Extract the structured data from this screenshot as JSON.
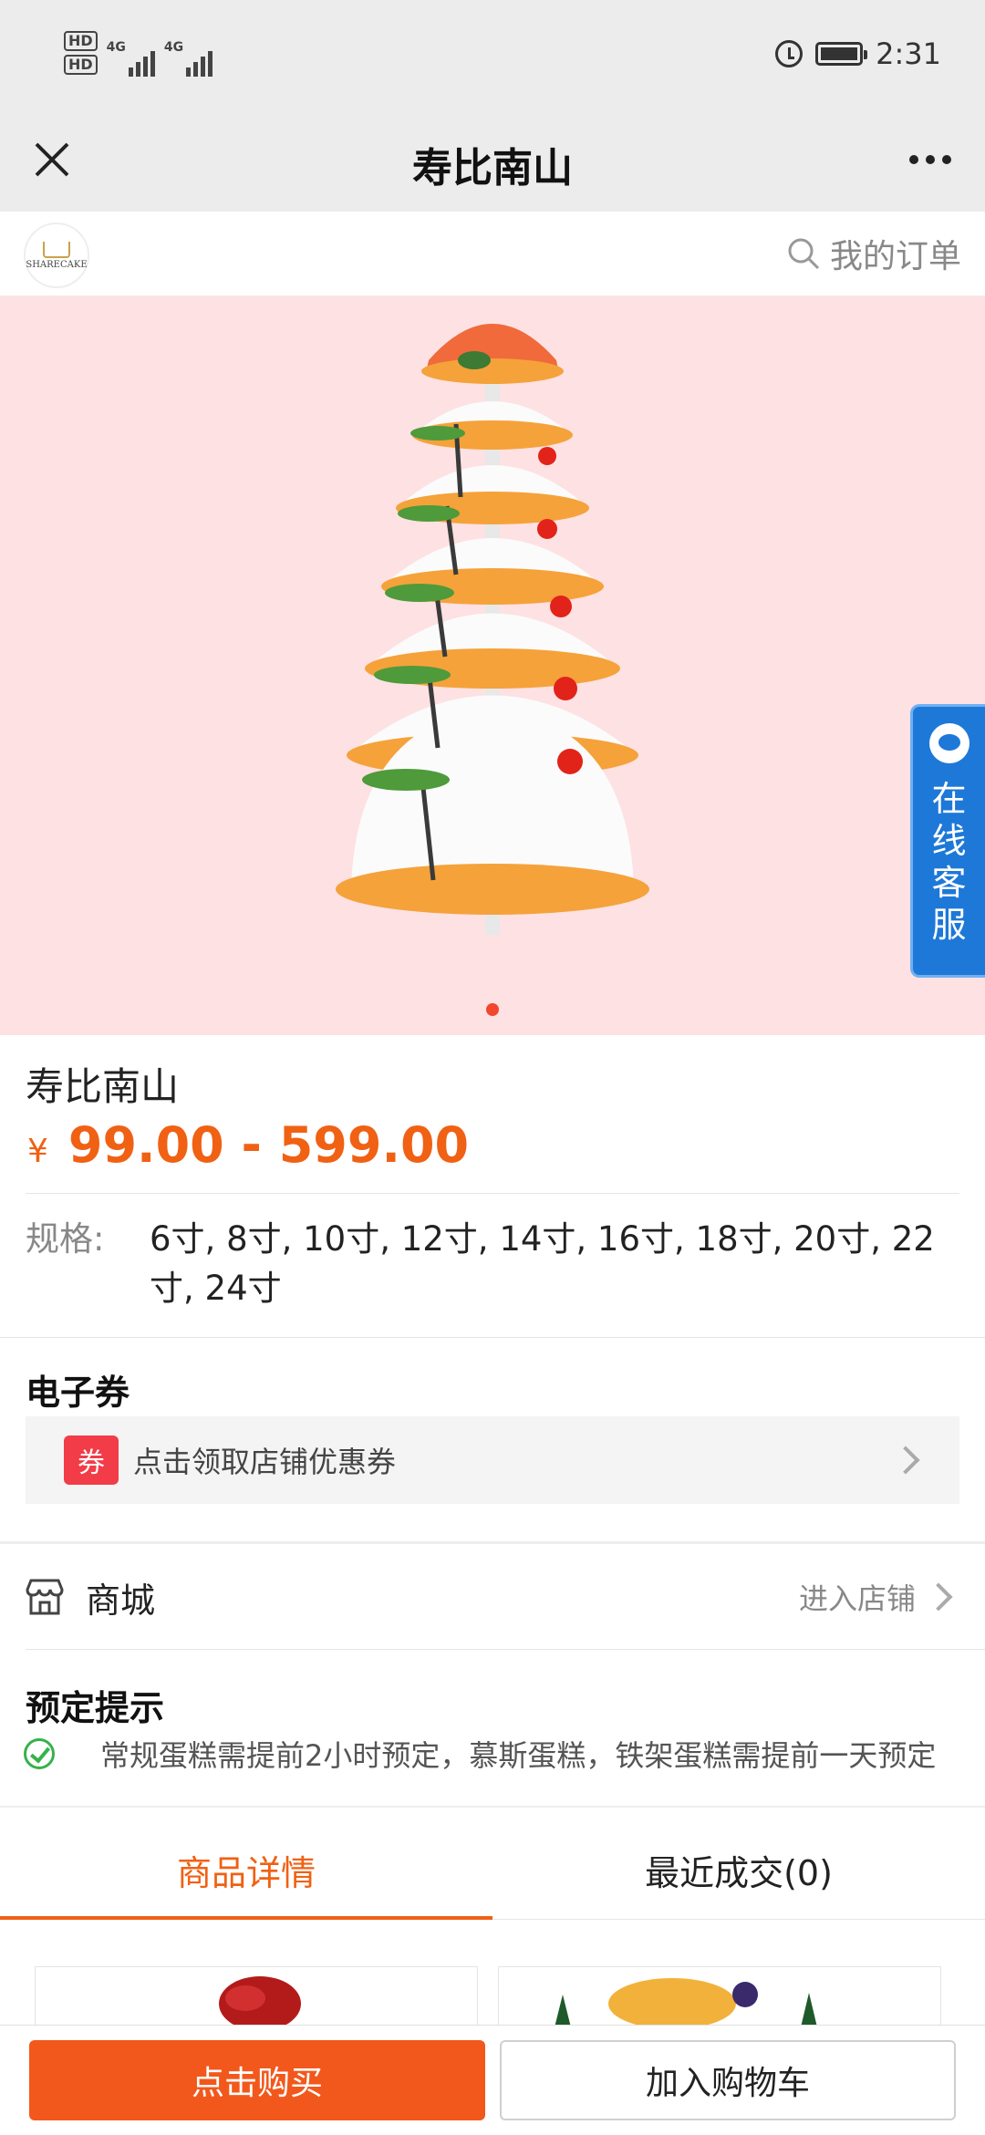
{
  "status_bar": {
    "hd1": "HD",
    "hd2": "HD",
    "net1": "4G",
    "net2": "4G",
    "time": "2:31"
  },
  "titlebar": {
    "title": "寿比南山"
  },
  "shop": {
    "logo_text": "SHARECAKE",
    "my_order": "我的订单"
  },
  "hero": {
    "carousel_index": 1,
    "carousel_total": 1
  },
  "service": {
    "label": "在线客服"
  },
  "product": {
    "name": "寿比南山",
    "currency": "¥",
    "price_range": "99.00 - 599.00",
    "spec_label": "规格:",
    "spec_values": "6寸, 8寸, 10寸, 12寸, 14寸, 16寸, 18寸, 20寸, 22寸, 24寸"
  },
  "coupon": {
    "section_title": "电子券",
    "tag": "券",
    "text": "点击领取店铺优惠券"
  },
  "mall": {
    "label": "商城",
    "enter": "进入店铺"
  },
  "booking": {
    "title": "预定提示",
    "tip": "常规蛋糕需提前2小时预定，慕斯蛋糕，铁架蛋糕需提前一天预定"
  },
  "tabs": [
    {
      "label": "商品详情",
      "active": true
    },
    {
      "label": "最近成交(0)",
      "active": false
    }
  ],
  "actions": {
    "buy": "点击购买",
    "add_cart": "加入购物车"
  },
  "colors": {
    "accent": "#f06114",
    "buy_button": "#f2581c",
    "hero_bg": "#fde1e3",
    "service": "#1d78d8"
  }
}
